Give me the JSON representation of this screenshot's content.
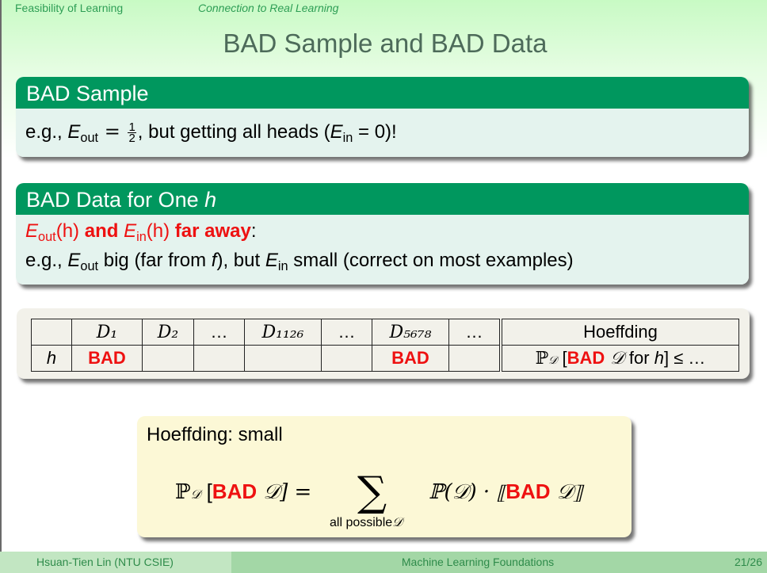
{
  "nav": {
    "section": "Feasibility of Learning",
    "subsection": "Connection to Real Learning"
  },
  "title": "BAD Sample and BAD Data",
  "block_bad_sample": {
    "heading": "BAD Sample",
    "prefix": "e.g., ",
    "E": "E",
    "out": "out",
    "eq": " = ",
    "frac_num": "1",
    "frac_den": "2",
    "mid": ", but getting all heads (",
    "in": "in",
    "eq0": " = 0)!"
  },
  "block_bad_data": {
    "heading_text": "BAD Data for One ",
    "heading_var": "h",
    "line1": {
      "E": "E",
      "out": "out",
      "h_paren": "(h)",
      "and": " and ",
      "in": "in",
      "far": " far away",
      "colon": ":"
    },
    "line2": {
      "prefix": "e.g., ",
      "E": "E",
      "out": "out",
      "mid1": " big (far from ",
      "f": "f",
      "mid2": "), but ",
      "in": "in",
      "suffix": " small (correct on most examples)"
    }
  },
  "table": {
    "header": [
      "",
      "D₁",
      "D₂",
      "…",
      "D₁₁₂₆",
      "…",
      "D₅₆₇₈",
      "…",
      "Hoeffding"
    ],
    "row": [
      "h",
      "BAD",
      "",
      "",
      "",
      "",
      "BAD",
      "",
      ""
    ],
    "hoeffding_cell": {
      "P": "ℙ",
      "D_sub": "𝒟",
      "open": " [",
      "bad": "BAD",
      "D": " 𝒟",
      "for": " for ",
      "h": "h",
      "close": "] ≤ …"
    }
  },
  "hoeffding_box": {
    "title": "Hoeffding: small",
    "lhs_P": "ℙ",
    "lhs_sub": "𝒟",
    "lhs_open": " [",
    "bad": "BAD",
    "lhs_D": " 𝒟] =",
    "sigma": "∑",
    "under": "all possible",
    "under_D": "𝒟",
    "rhs_P": "ℙ(𝒟) · ⟦",
    "rhs_D": " 𝒟⟧"
  },
  "footer": {
    "author": "Hsuan-Tien Lin  (NTU CSIE)",
    "course": "Machine Learning Foundations",
    "page": "21/26"
  },
  "colors": {
    "block_header": "#00975e",
    "block_body": "#e4f3ee",
    "emphasis_red": "#ee1111",
    "nav_green": "#2e9e55",
    "title_color": "#4d6b5a",
    "yellow_box": "#fcf8d6",
    "table_box": "#f2f1ea"
  }
}
